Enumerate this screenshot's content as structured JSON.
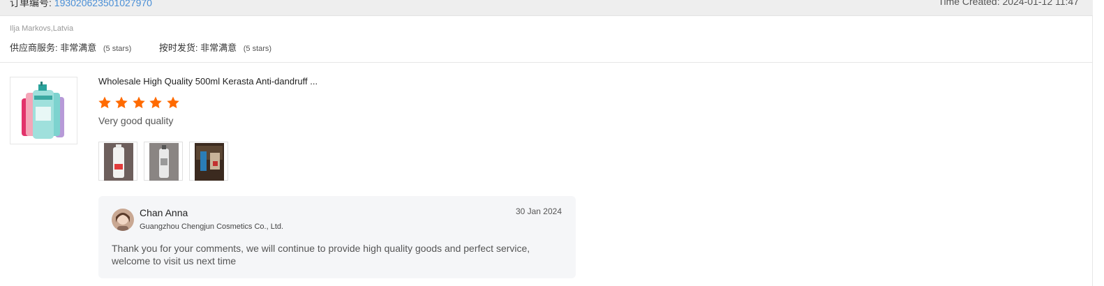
{
  "order": {
    "label": "订单编号:",
    "number": "193020623501027970"
  },
  "created": {
    "text": "Time Created: 2024-01-12 11:47"
  },
  "buyer": {
    "name_location": "Ilja Markovs,Latvia"
  },
  "ratings": [
    {
      "label": "供应商服务:",
      "value": "非常满意",
      "stars_text": "(5 stars)"
    },
    {
      "label": "按时发货:",
      "value": "非常满意",
      "stars_text": "(5 stars)"
    }
  ],
  "product": {
    "title": "Wholesale High Quality 500ml Kerasta Anti-dandruff ...",
    "rating": 5,
    "comment": "Very good quality",
    "thumb_icon": "shampoo-bottles-image",
    "photo_icons": [
      "review-photo-white-bottle",
      "review-photo-gray-bottle",
      "review-photo-box"
    ]
  },
  "reply": {
    "name": "Chan Anna",
    "company": "Guangzhou Chengjun Cosmetics Co., Ltd.",
    "date": "30 Jan 2024",
    "text": "Thank you for your comments, we will continue to provide high quality goods and perfect service, welcome to visit us next time"
  },
  "colors": {
    "star": "#ff6a00",
    "link": "#4a8fd6",
    "reply_bg": "#f5f6f8"
  }
}
